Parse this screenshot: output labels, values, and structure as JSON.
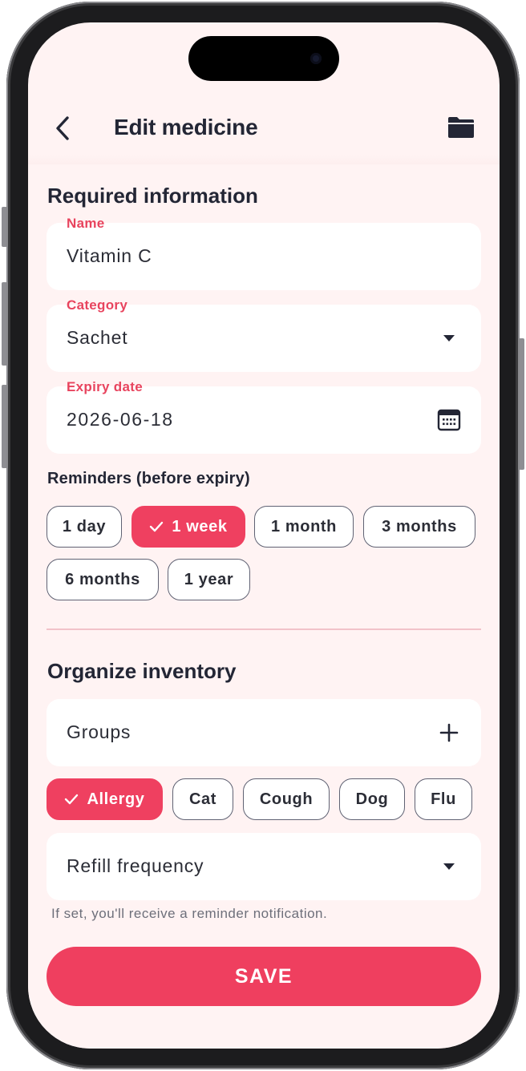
{
  "header": {
    "title": "Edit medicine",
    "back_icon": "chevron-left-icon",
    "folder_icon": "folder-icon"
  },
  "required": {
    "title": "Required information",
    "name": {
      "label": "Name",
      "value": "Vitamin C"
    },
    "category": {
      "label": "Category",
      "value": "Sachet",
      "icon": "caret-down-icon"
    },
    "expiry": {
      "label": "Expiry date",
      "value": "2026-06-18",
      "icon": "calendar-icon"
    }
  },
  "reminders": {
    "title": "Reminders (before expiry)",
    "options": [
      {
        "label": "1 day",
        "selected": false
      },
      {
        "label": "1 week",
        "selected": true
      },
      {
        "label": "1 month",
        "selected": false
      },
      {
        "label": "3 months",
        "selected": false
      },
      {
        "label": "6 months",
        "selected": false
      },
      {
        "label": "1 year",
        "selected": false
      }
    ]
  },
  "inventory": {
    "title": "Organize inventory",
    "groups": {
      "label": "Groups",
      "icon": "plus-icon"
    },
    "group_chips": [
      {
        "label": "Allergy",
        "selected": true
      },
      {
        "label": "Cat",
        "selected": false
      },
      {
        "label": "Cough",
        "selected": false
      },
      {
        "label": "Dog",
        "selected": false
      },
      {
        "label": "Flu",
        "selected": false
      }
    ],
    "refill": {
      "label": "Refill frequency",
      "icon": "caret-down-icon"
    },
    "hint": "If set, you'll receive a reminder notification."
  },
  "save_label": "SAVE",
  "colors": {
    "accent": "#ef4060",
    "label": "#e8445e",
    "background": "#fff3f3",
    "text": "#232635"
  }
}
